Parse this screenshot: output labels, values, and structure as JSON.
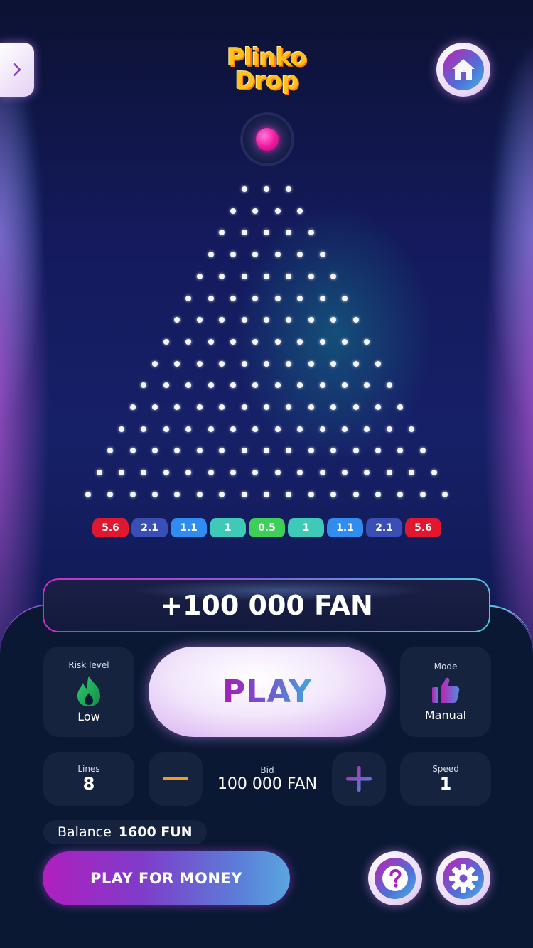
{
  "logo": {
    "line1": "Plinko",
    "line2": "Drop"
  },
  "board": {
    "rows": 8,
    "multipliers": [
      {
        "label": "5.6",
        "color": "#e0182f"
      },
      {
        "label": "2.1",
        "color": "#3a4fb5"
      },
      {
        "label": "1.1",
        "color": "#2f8cf0"
      },
      {
        "label": "1",
        "color": "#3fc9b9"
      },
      {
        "label": "0.5",
        "color": "#3ecf5a"
      },
      {
        "label": "1",
        "color": "#3fc9b9"
      },
      {
        "label": "1.1",
        "color": "#2f8cf0"
      },
      {
        "label": "2.1",
        "color": "#3a4fb5"
      },
      {
        "label": "5.6",
        "color": "#e0182f"
      }
    ]
  },
  "win": {
    "text": "+100 000 FAN"
  },
  "risk": {
    "label": "Risk level",
    "value": "Low",
    "icon": "flame-icon"
  },
  "play": {
    "label": "PLAY"
  },
  "mode": {
    "label": "Mode",
    "value": "Manual",
    "icon": "thumbs-up-icon"
  },
  "lines": {
    "label": "Lines",
    "value": "8"
  },
  "bid": {
    "label": "Bid",
    "value": "100 000 FAN"
  },
  "speed": {
    "label": "Speed",
    "value": "1"
  },
  "balance": {
    "label": "Balance",
    "value": "1600 FUN"
  },
  "money_button": {
    "label": "PLAY FOR MONEY"
  },
  "colors": {
    "accent_pink": "#c21fb2",
    "accent_blue": "#46b3e6",
    "panel": "#0a1833",
    "card": "#16233f",
    "minus": "#f39a2b"
  }
}
